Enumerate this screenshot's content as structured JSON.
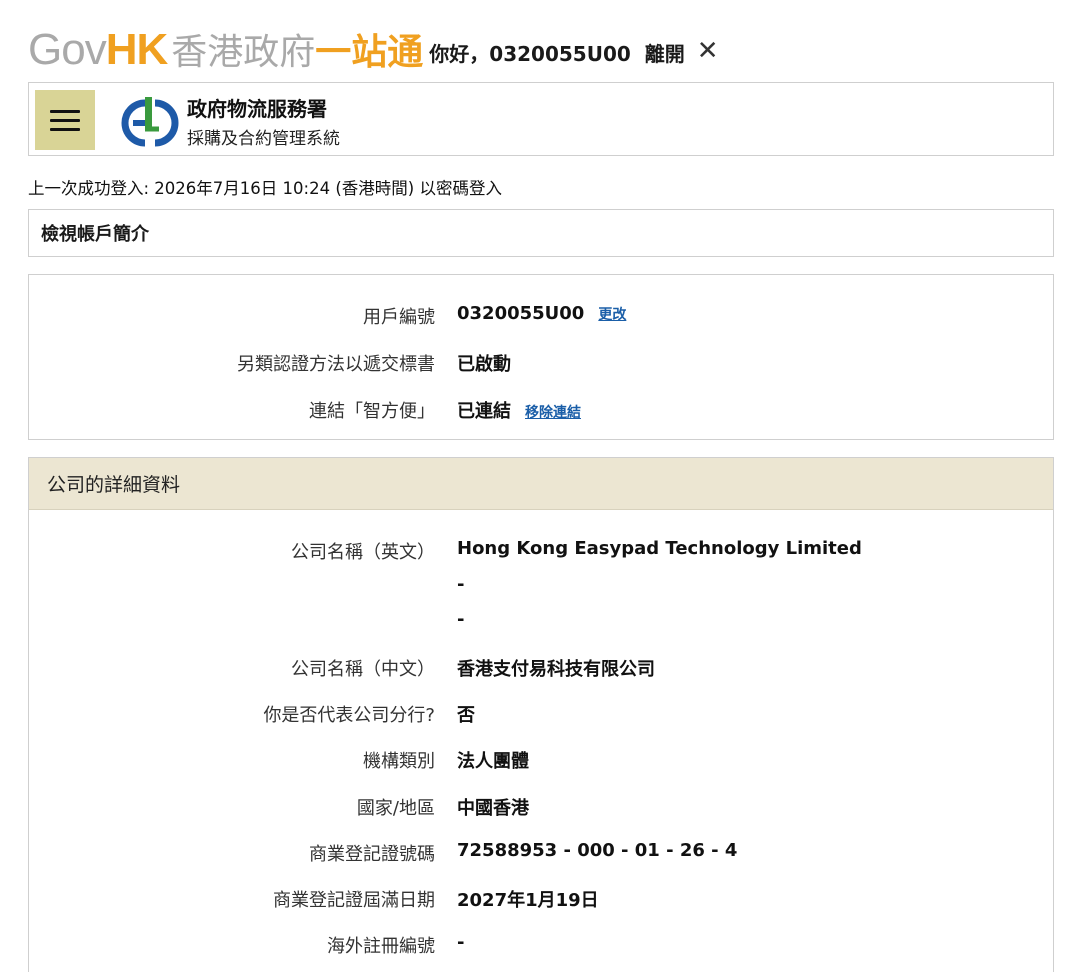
{
  "top": {
    "logo_gov": "Gov",
    "logo_hk": "HK",
    "logo_zh1": "香港政府",
    "logo_zh2": "一站通",
    "greeting": "你好，0320055U00",
    "logout": "離開",
    "close": "✕"
  },
  "header": {
    "title": "政府物流服務署",
    "subtitle": "採購及合約管理系統"
  },
  "last_login": "上一次成功登入: 2026年7月16日 10:24 (香港時間) 以密碼登入",
  "page_title": "檢視帳戶簡介",
  "account": {
    "user_id_label": "用戶編號",
    "user_id_value": "0320055U00",
    "user_id_link": "更改",
    "alt_auth_label": "另類認證方法以遞交標書",
    "alt_auth_value": "已啟動",
    "iam_label": "連結「智方便」",
    "iam_value": "已連結",
    "iam_link": "移除連結"
  },
  "company": {
    "header": "公司的詳細資料",
    "name_en_label": "公司名稱（英文）",
    "name_en_value": "Hong Kong Easypad Technology Limited",
    "name_en_line2": "-",
    "name_en_line3": "-",
    "name_zh_label": "公司名稱（中文）",
    "name_zh_value": "香港支付易科技有限公司",
    "branch_label": "你是否代表公司分行?",
    "branch_value": "否",
    "org_type_label": "機構類別",
    "org_type_value": "法人團體",
    "country_label": "國家/地區",
    "country_value": "中國香港",
    "br_no_label": "商業登記證號碼",
    "br_no_value": "72588953 - 000 - 01 - 26 - 4",
    "br_expiry_label": "商業登記證屆滿日期",
    "br_expiry_value": "2027年1月19日",
    "overseas_label": "海外註冊編號",
    "overseas_value": "-"
  },
  "colors": {
    "govhk_grey": "#a9a9a9",
    "govhk_orange": "#f0a020",
    "menu_bg": "#d9d496",
    "link_blue": "#1a5ea8",
    "section_header_bg": "#ece6d2",
    "gld_blue": "#1e5aa8",
    "gld_green": "#3a9a3e"
  }
}
